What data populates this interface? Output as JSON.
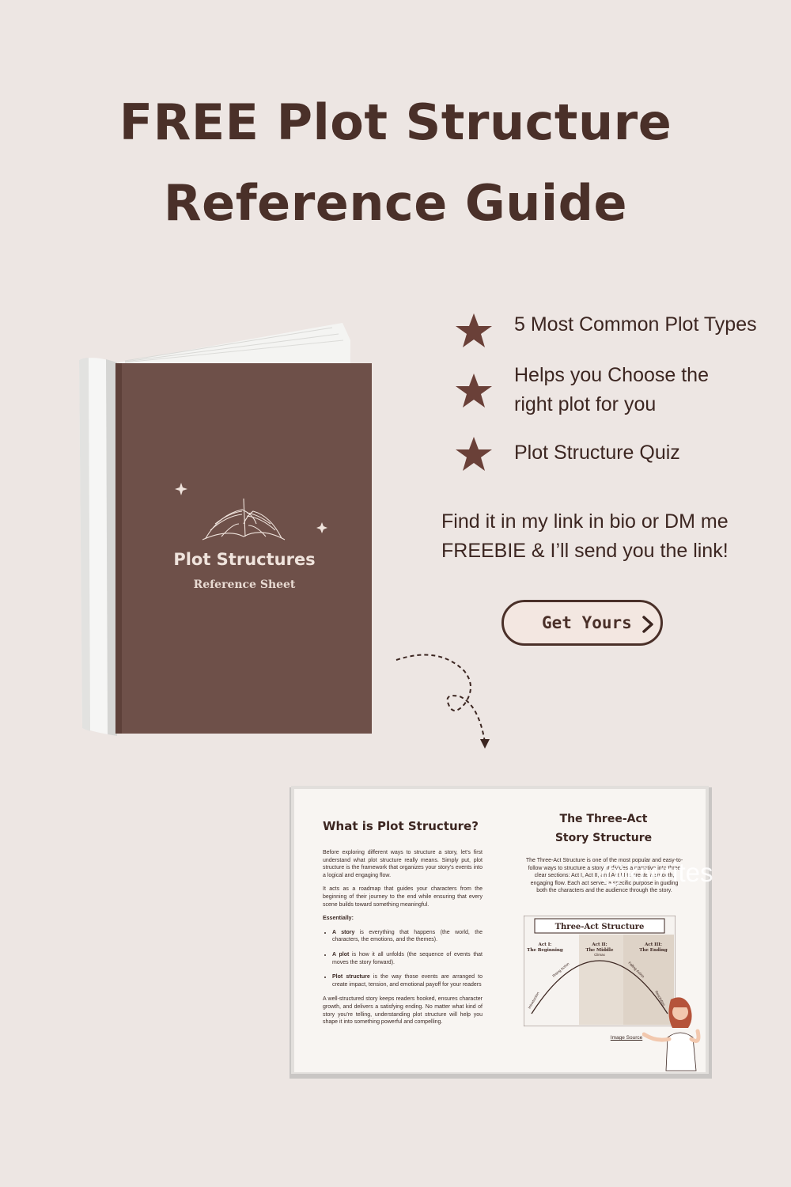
{
  "title": {
    "line1": "FREE Plot Structure",
    "line2": "Reference Guide"
  },
  "book_cover": {
    "title": "Plot Structures",
    "subtitle": "Reference Sheet",
    "cover_color": "#6e5049"
  },
  "features": [
    {
      "icon": "star-icon",
      "line1": "5 Most Common Plot Types",
      "line2": ""
    },
    {
      "icon": "star-icon",
      "line1": "Helps you Choose the",
      "line2": "right plot for you"
    },
    {
      "icon": "star-icon",
      "line1": "Plot Structure Quiz",
      "line2": ""
    }
  ],
  "find_text": {
    "line1": "Find it in my link in bio or DM me",
    "line2": "FREEBIE & I’ll send you the link!"
  },
  "cta": {
    "label": "Get Yours",
    "icon": "chevron-right-icon"
  },
  "preview": {
    "left_page": {
      "heading": "What is Plot Structure?",
      "para1": "Before exploring different ways to structure a story, let’s first understand what plot structure really means. Simply put, plot structure is the framework that organizes your story’s events into a logical and engaging flow.",
      "para2": "It acts as a roadmap that guides your characters from the beginning of their journey to the end while ensuring that every scene builds toward something meaningful.",
      "essentially": "Essentially:",
      "bullets": [
        {
          "bold": "A story",
          "text": " is everything that happens (the world, the characters, the emotions, and the themes)."
        },
        {
          "bold": "A plot",
          "text": " is how it all unfolds (the sequence of events that moves the story forward)."
        },
        {
          "bold": "Plot structure",
          "text": " is the way those events are arranged to create impact, tension, and emotional payoff for your readers"
        }
      ],
      "para3": "A well-structured story keeps readers hooked, ensures character growth, and delivers a satisfying ending. No matter what kind of story you’re telling, understanding plot structure will help you shape it into something powerful and compelling."
    },
    "right_page": {
      "heading1": "The Three-Act",
      "heading2": "Story Structure",
      "intro": "The Three-Act Structure is one of the most popular and easy-to-follow ways to structure a story. It divides a narrative into three clear sections: Act I, Act II, and Act III to create a smooth, engaging flow. Each act serves a specific purpose in guiding both the characters and the audience through the story.",
      "chart_title": "Three-Act Structure",
      "acts": [
        {
          "label1": "Act I:",
          "label2": "The Beginning"
        },
        {
          "label1": "Act II:",
          "label2": "The Middle"
        },
        {
          "label1": "Act III:",
          "label2": "The Ending"
        }
      ],
      "stages": [
        "Introduction",
        "Rising Action",
        "Climax",
        "Falling Action",
        "Resolution"
      ],
      "image_source": "Image Source"
    },
    "watermark": "@kiwrites"
  }
}
